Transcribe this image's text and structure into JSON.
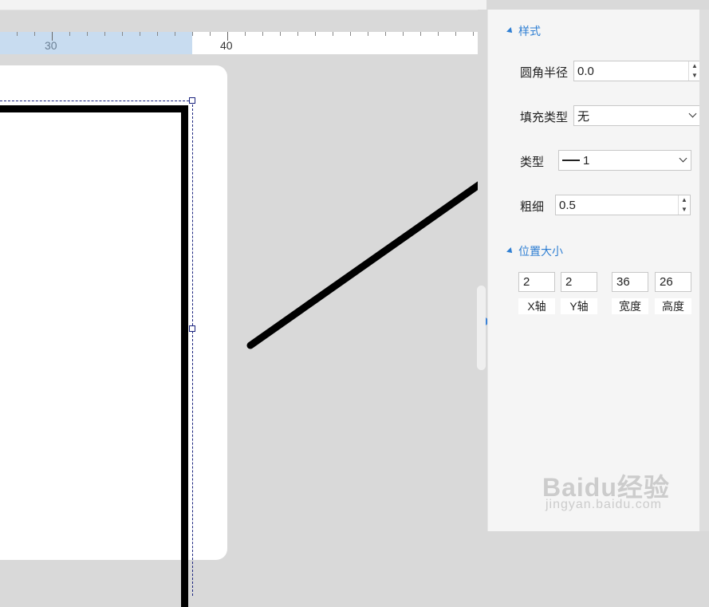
{
  "ruler": {
    "labels": [
      "30",
      "40"
    ]
  },
  "panel": {
    "style_section": {
      "title": "样式",
      "corner_radius_label": "圆角半径",
      "corner_radius_value": "0.0",
      "fill_type_label": "填充类型",
      "fill_type_value": "无",
      "line_type_label": "类型",
      "line_type_value": "1",
      "thickness_label": "粗细",
      "thickness_value": "0.5"
    },
    "position_section": {
      "title": "位置大小",
      "fields": [
        {
          "label": "X轴",
          "value": "2"
        },
        {
          "label": "Y轴",
          "value": "2"
        },
        {
          "label": "宽度",
          "value": "36"
        },
        {
          "label": "高度",
          "value": "26"
        }
      ]
    }
  },
  "watermark": {
    "brand": "Baidu经验",
    "url": "jingyan.baidu.com"
  },
  "colors": {
    "accent": "#2f7fd3",
    "ruler_highlight": "#c8dcf0",
    "selection": "#1a237e"
  }
}
